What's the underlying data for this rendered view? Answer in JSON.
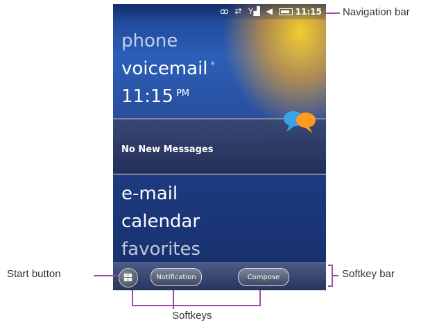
{
  "status_bar": {
    "icons": [
      "voicemail-icon",
      "data-transfer-icon",
      "signal-icon",
      "speaker-icon",
      "battery-icon"
    ],
    "time": "11:15"
  },
  "home": {
    "items": [
      {
        "label": "phone"
      },
      {
        "label": "voicemail",
        "marker": "*"
      },
      {
        "label": "11:15",
        "suffix": "PM"
      }
    ],
    "message_panel": {
      "text": "No New Messages"
    },
    "lower_items": [
      {
        "label": "e-mail"
      },
      {
        "label": "calendar"
      },
      {
        "label": "favorites"
      }
    ]
  },
  "softkeys": {
    "left_label": "Notification",
    "right_label": "Compose"
  },
  "annotations": {
    "navigation_bar": "Navigation bar",
    "start_button": "Start button",
    "softkey_bar": "Softkey bar",
    "softkeys": "Softkeys"
  },
  "colors": {
    "annotation_line": "#a347b3",
    "screen_blue": "#2a4f9f",
    "glow": "#ffb020"
  }
}
